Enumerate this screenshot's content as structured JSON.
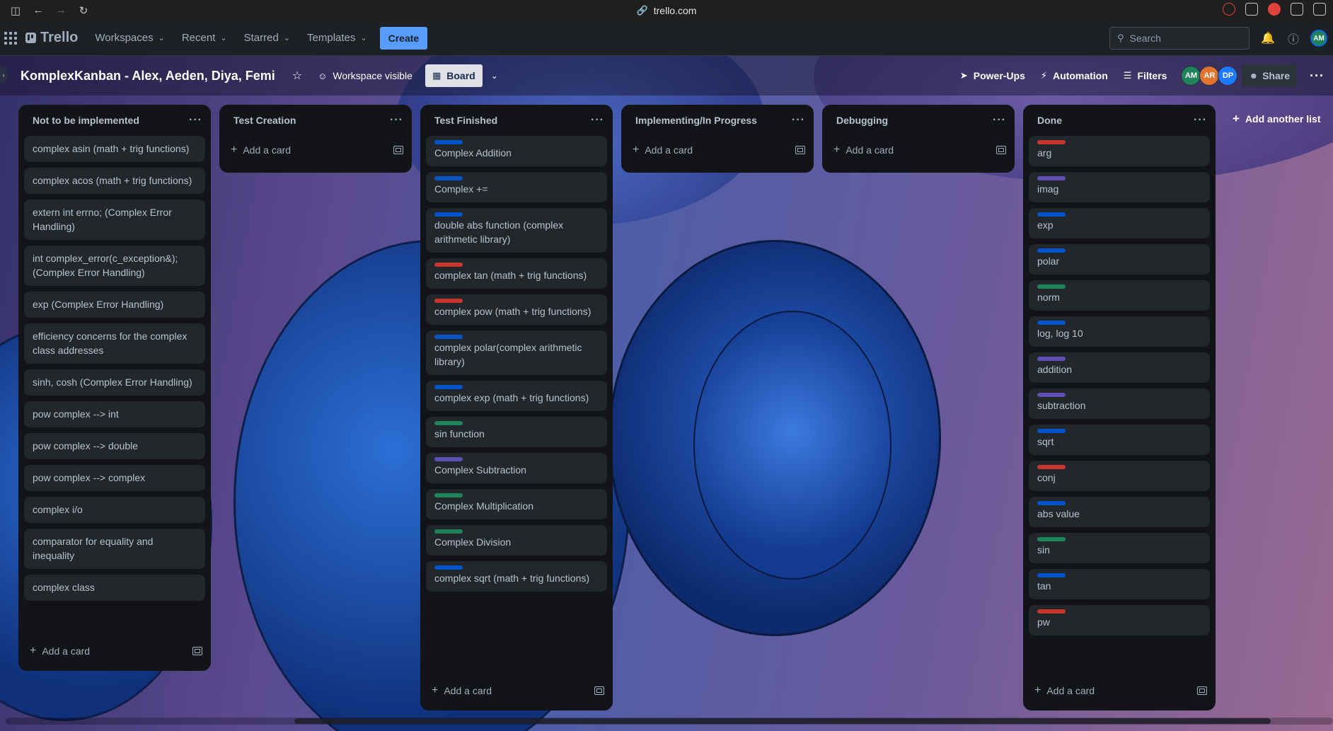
{
  "browser": {
    "url": "trello.com"
  },
  "nav": {
    "logo": "Trello",
    "menu": [
      {
        "label": "Workspaces"
      },
      {
        "label": "Recent"
      },
      {
        "label": "Starred"
      },
      {
        "label": "Templates"
      }
    ],
    "create_label": "Create",
    "search_placeholder": "Search",
    "user_initials": "AM"
  },
  "board": {
    "title": "KomplexKanban - Alex, Aeden, Diya, Femi",
    "visibility_label": "Workspace visible",
    "view_label": "Board",
    "powerups_label": "Power-Ups",
    "automation_label": "Automation",
    "filters_label": "Filters",
    "share_label": "Share",
    "members": [
      {
        "initials": "AM",
        "color": "#1f845a"
      },
      {
        "initials": "AR",
        "color": "#e2742f"
      },
      {
        "initials": "DP",
        "color": "#1d7afc"
      }
    ],
    "add_list_label": "Add another list"
  },
  "colors": {
    "blue": "#0055cc",
    "red": "#c9372c",
    "green": "#1f845a",
    "purple": "#5e4db2"
  },
  "lists": [
    {
      "title": "Not to be implemented",
      "add_card_label": "Add a card",
      "cards": [
        {
          "text": "complex asin (math + trig functions)"
        },
        {
          "text": "complex acos (math + trig functions)"
        },
        {
          "text": "extern int errno; (Complex Error Handling)"
        },
        {
          "text": "int complex_error(c_exception&); (Complex Error Handling)"
        },
        {
          "text": "exp (Complex Error Handling)"
        },
        {
          "text": "efficiency concerns for the complex class addresses"
        },
        {
          "text": "sinh, cosh (Complex Error Handling)"
        },
        {
          "text": "pow complex --> int"
        },
        {
          "text": "pow complex --> double"
        },
        {
          "text": "pow complex --> complex"
        },
        {
          "text": "complex i/o"
        },
        {
          "text": "comparator for equality and inequality"
        },
        {
          "text": "complex class"
        }
      ]
    },
    {
      "title": "Test Creation",
      "add_card_label": "Add a card",
      "cards": []
    },
    {
      "title": "Test Finished",
      "add_card_label": "Add a card",
      "cards": [
        {
          "text": "Complex Addition",
          "label": "blue"
        },
        {
          "text": "Complex +=",
          "label": "blue"
        },
        {
          "text": "double abs function (complex arithmetic library)",
          "label": "blue"
        },
        {
          "text": "complex tan (math + trig functions)",
          "label": "red"
        },
        {
          "text": "complex pow (math + trig functions)",
          "label": "red"
        },
        {
          "text": "complex polar(complex arithmetic library)",
          "label": "blue"
        },
        {
          "text": "complex exp (math + trig functions)",
          "label": "blue"
        },
        {
          "text": "sin function",
          "label": "green"
        },
        {
          "text": "Complex Subtraction",
          "label": "purple"
        },
        {
          "text": "Complex Multiplication",
          "label": "green"
        },
        {
          "text": "Complex Division",
          "label": "green"
        },
        {
          "text": "complex sqrt (math + trig functions)",
          "label": "blue"
        }
      ]
    },
    {
      "title": "Implementing/In Progress",
      "add_card_label": "Add a card",
      "cards": []
    },
    {
      "title": "Debugging",
      "add_card_label": "Add a card",
      "cards": []
    },
    {
      "title": "Done",
      "add_card_label": "Add a card",
      "cards": [
        {
          "text": "arg",
          "label": "red"
        },
        {
          "text": "imag",
          "label": "purple"
        },
        {
          "text": "exp",
          "label": "blue"
        },
        {
          "text": "polar",
          "label": "blue"
        },
        {
          "text": "norm",
          "label": "green"
        },
        {
          "text": "log, log 10",
          "label": "blue"
        },
        {
          "text": "addition",
          "label": "purple"
        },
        {
          "text": "subtraction",
          "label": "purple"
        },
        {
          "text": "sqrt",
          "label": "blue"
        },
        {
          "text": "conj",
          "label": "red"
        },
        {
          "text": "abs value",
          "label": "blue"
        },
        {
          "text": "sin",
          "label": "green"
        },
        {
          "text": "tan",
          "label": "blue"
        },
        {
          "text": "pw",
          "label": "red"
        }
      ]
    }
  ]
}
